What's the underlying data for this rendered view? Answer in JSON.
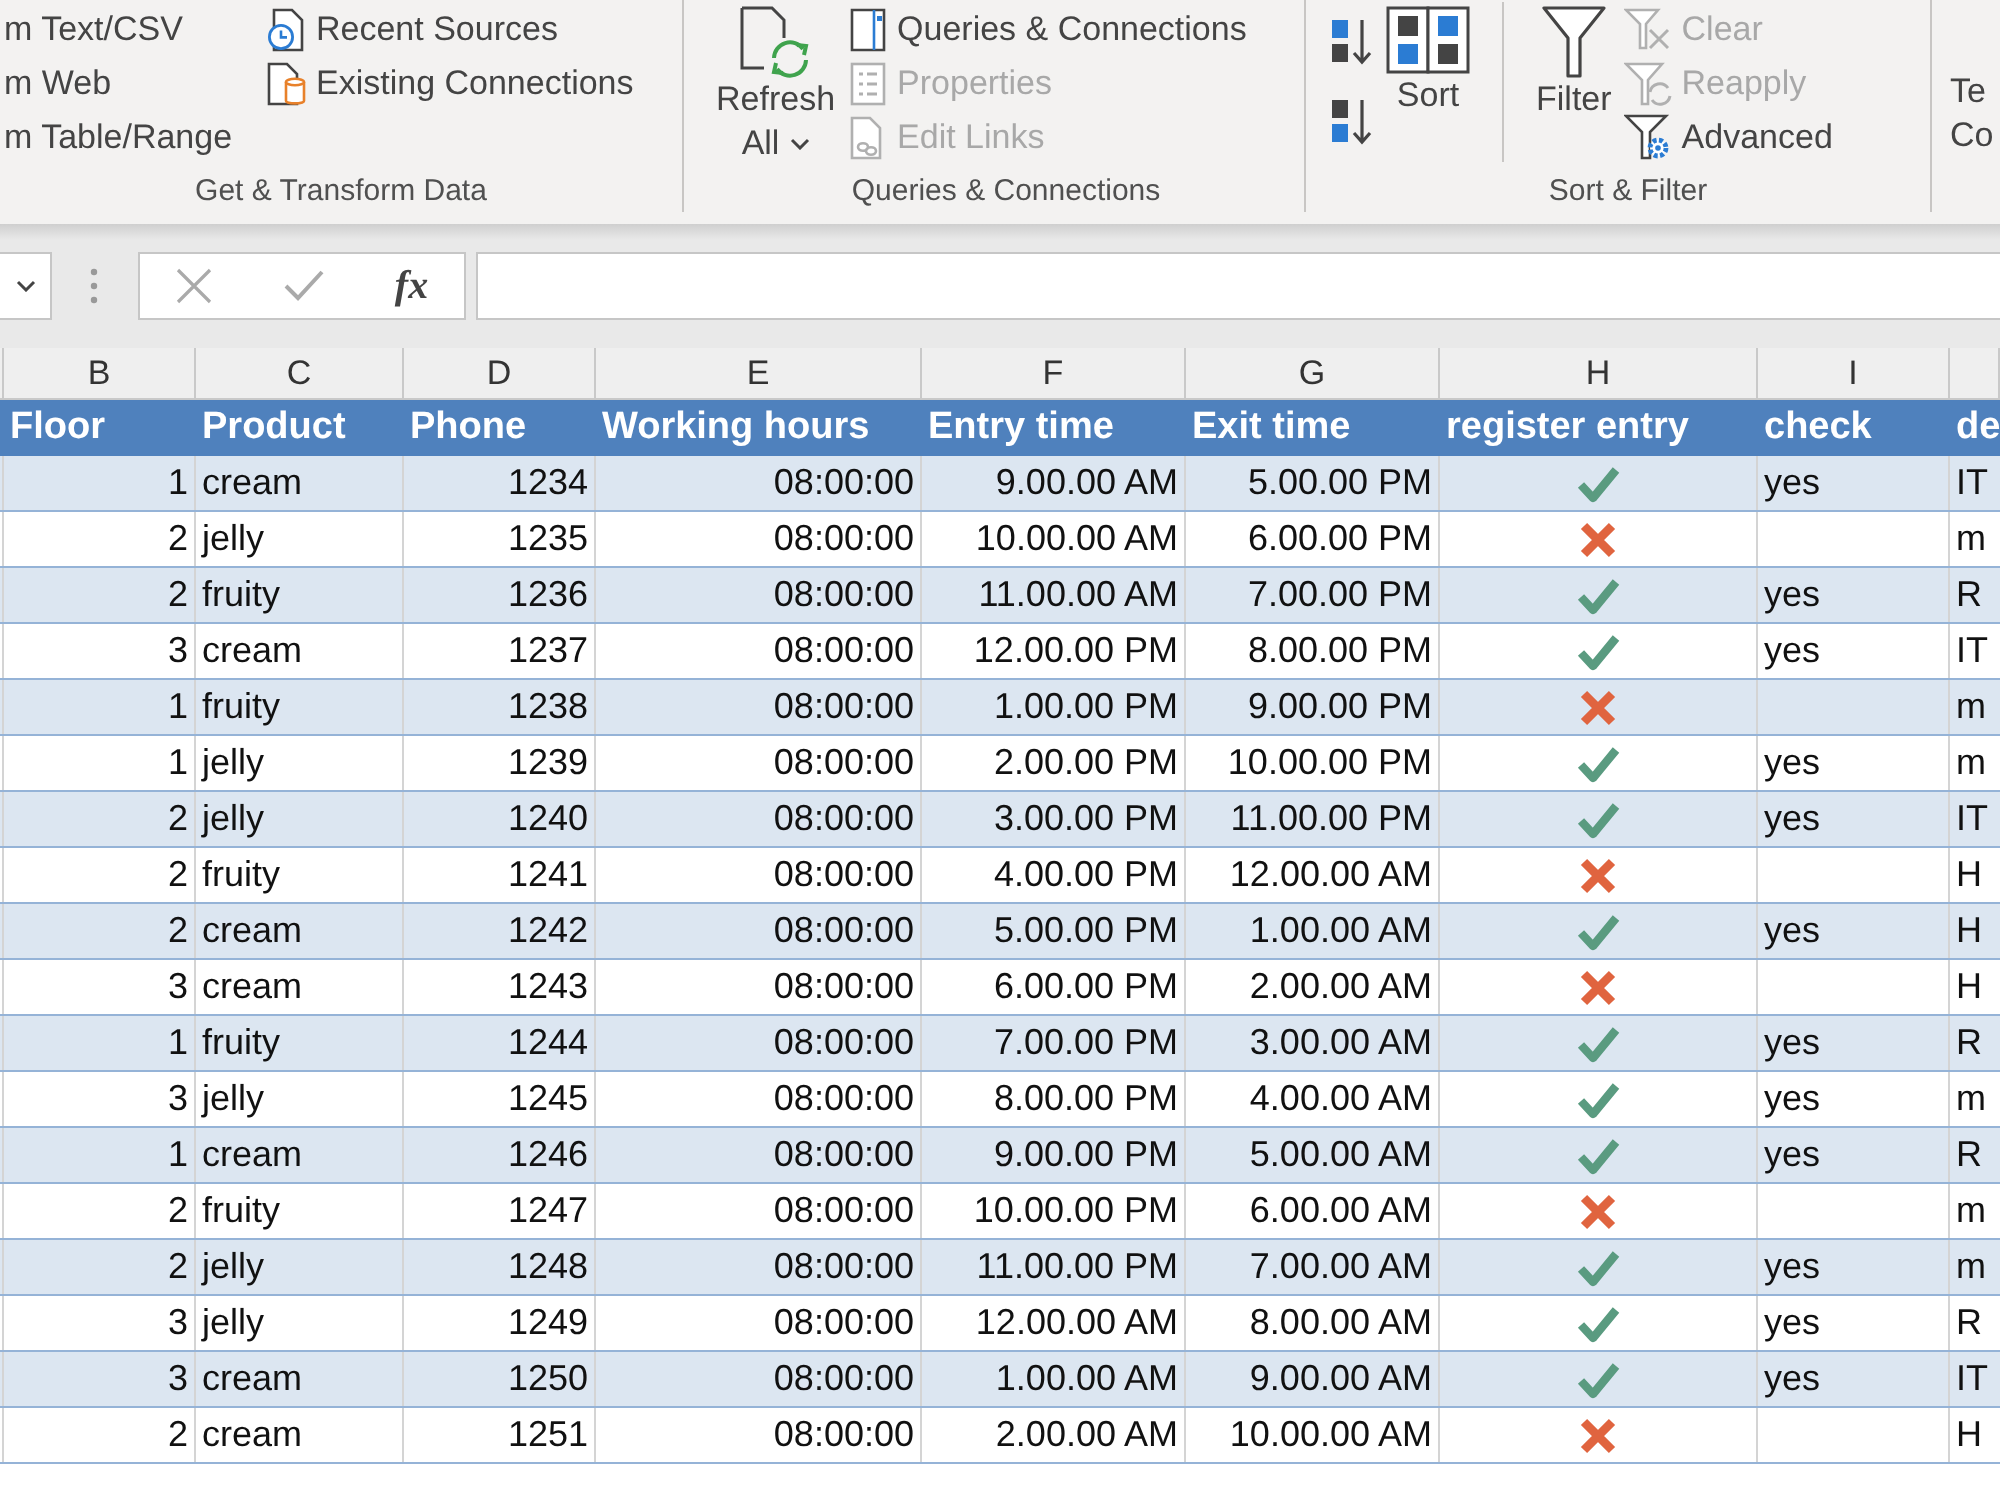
{
  "ribbon": {
    "get_transform": {
      "label": "Get & Transform Data",
      "from_items": [
        "m Text/CSV",
        "m Web",
        "m Table/Range"
      ],
      "sources": [
        "Recent Sources",
        "Existing Connections"
      ]
    },
    "queries": {
      "label": "Queries & Connections",
      "refresh_all": [
        "Refresh",
        "All"
      ],
      "items": [
        {
          "label": "Queries & Connections",
          "disabled": false
        },
        {
          "label": "Properties",
          "disabled": true
        },
        {
          "label": "Edit Links",
          "disabled": true
        }
      ]
    },
    "sort_filter": {
      "label": "Sort & Filter",
      "sort": "Sort",
      "filter": "Filter",
      "items": [
        {
          "label": "Clear",
          "disabled": true
        },
        {
          "label": "Reapply",
          "disabled": true
        },
        {
          "label": "Advanced",
          "disabled": false
        }
      ]
    },
    "data_tools": {
      "text_to_columns": [
        "Te",
        "Co"
      ]
    }
  },
  "formula_bar": {
    "insert_function": "fx"
  },
  "sheet": {
    "column_letters": [
      "B",
      "C",
      "D",
      "E",
      "F",
      "G",
      "H",
      "I"
    ],
    "headers": [
      "Floor",
      "Product",
      "Phone",
      "Working hours",
      "Entry time",
      "Exit time",
      "register entry",
      "check",
      "de"
    ],
    "rows": [
      {
        "floor": "1",
        "product": "cream",
        "phone": "1234",
        "working_hours": "08:00:00",
        "entry_time": "9.00.00 AM",
        "exit_time": "5.00.00 PM",
        "registered": true,
        "check": "yes",
        "column_9": "IT"
      },
      {
        "floor": "2",
        "product": "jelly",
        "phone": "1235",
        "working_hours": "08:00:00",
        "entry_time": "10.00.00 AM",
        "exit_time": "6.00.00 PM",
        "registered": false,
        "column_9": "m"
      },
      {
        "floor": "2",
        "product": "fruity",
        "phone": "1236",
        "working_hours": "08:00:00",
        "entry_time": "11.00.00 AM",
        "exit_time": "7.00.00 PM",
        "registered": true,
        "check": "yes",
        "column_9": "R"
      },
      {
        "floor": "3",
        "product": "cream",
        "phone": "1237",
        "working_hours": "08:00:00",
        "entry_time": "12.00.00 PM",
        "exit_time": "8.00.00 PM",
        "registered": true,
        "check": "yes",
        "column_9": "IT"
      },
      {
        "floor": "1",
        "product": "fruity",
        "phone": "1238",
        "working_hours": "08:00:00",
        "entry_time": "1.00.00 PM",
        "exit_time": "9.00.00 PM",
        "registered": false,
        "column_9": "m"
      },
      {
        "floor": "1",
        "product": "jelly",
        "phone": "1239",
        "working_hours": "08:00:00",
        "entry_time": "2.00.00 PM",
        "exit_time": "10.00.00 PM",
        "registered": true,
        "check": "yes",
        "column_9": "m"
      },
      {
        "floor": "2",
        "product": "jelly",
        "phone": "1240",
        "working_hours": "08:00:00",
        "entry_time": "3.00.00 PM",
        "exit_time": "11.00.00 PM",
        "registered": true,
        "check": "yes",
        "column_9": "IT"
      },
      {
        "floor": "2",
        "product": "fruity",
        "phone": "1241",
        "working_hours": "08:00:00",
        "entry_time": "4.00.00 PM",
        "exit_time": "12.00.00 AM",
        "registered": false,
        "column_9": "H"
      },
      {
        "floor": "2",
        "product": "cream",
        "phone": "1242",
        "working_hours": "08:00:00",
        "entry_time": "5.00.00 PM",
        "exit_time": "1.00.00 AM",
        "registered": true,
        "check": "yes",
        "column_9": "H"
      },
      {
        "floor": "3",
        "product": "cream",
        "phone": "1243",
        "working_hours": "08:00:00",
        "entry_time": "6.00.00 PM",
        "exit_time": "2.00.00 AM",
        "registered": false,
        "column_9": "H"
      },
      {
        "floor": "1",
        "product": "fruity",
        "phone": "1244",
        "working_hours": "08:00:00",
        "entry_time": "7.00.00 PM",
        "exit_time": "3.00.00 AM",
        "registered": true,
        "check": "yes",
        "column_9": "R"
      },
      {
        "floor": "3",
        "product": "jelly",
        "phone": "1245",
        "working_hours": "08:00:00",
        "entry_time": "8.00.00 PM",
        "exit_time": "4.00.00 AM",
        "registered": true,
        "check": "yes",
        "column_9": "m"
      },
      {
        "floor": "1",
        "product": "cream",
        "phone": "1246",
        "working_hours": "08:00:00",
        "entry_time": "9.00.00 PM",
        "exit_time": "5.00.00 AM",
        "registered": true,
        "check": "yes",
        "column_9": "R"
      },
      {
        "floor": "2",
        "product": "fruity",
        "phone": "1247",
        "working_hours": "08:00:00",
        "entry_time": "10.00.00 PM",
        "exit_time": "6.00.00 AM",
        "registered": false,
        "column_9": "m"
      },
      {
        "floor": "2",
        "product": "jelly",
        "phone": "1248",
        "working_hours": "08:00:00",
        "entry_time": "11.00.00 PM",
        "exit_time": "7.00.00 AM",
        "registered": true,
        "check": "yes",
        "column_9": "m"
      },
      {
        "floor": "3",
        "product": "jelly",
        "phone": "1249",
        "working_hours": "08:00:00",
        "entry_time": "12.00.00 AM",
        "exit_time": "8.00.00 AM",
        "registered": true,
        "check": "yes",
        "column_9": "R"
      },
      {
        "floor": "3",
        "product": "cream",
        "phone": "1250",
        "working_hours": "08:00:00",
        "entry_time": "1.00.00 AM",
        "exit_time": "9.00.00 AM",
        "registered": true,
        "check": "yes",
        "column_9": "IT"
      },
      {
        "floor": "2",
        "product": "cream",
        "phone": "1251",
        "working_hours": "08:00:00",
        "entry_time": "2.00.00 AM",
        "exit_time": "10.00.00 AM",
        "registered": false,
        "column_9": "H"
      }
    ]
  }
}
